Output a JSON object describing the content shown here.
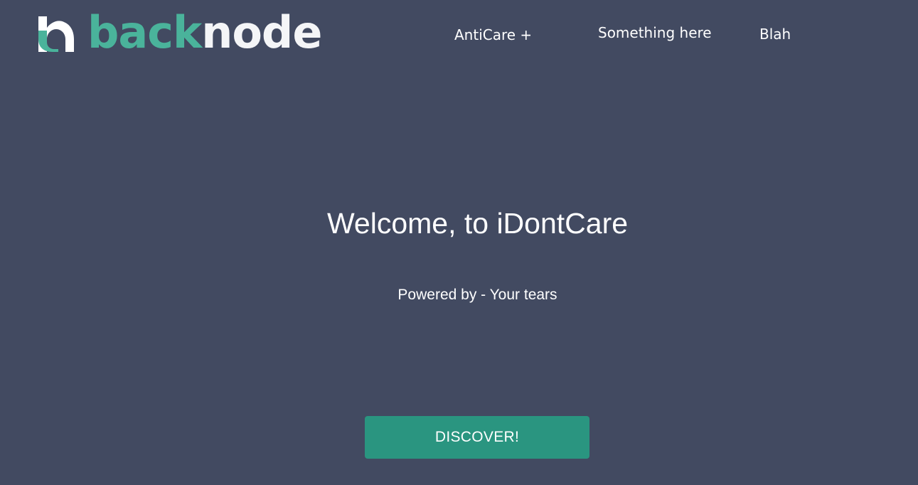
{
  "brand": {
    "name_part1": "back",
    "name_part2": "node",
    "accent_color": "#4ab39b",
    "text_color": "#f4f5f7"
  },
  "nav": {
    "items": [
      {
        "label": "AntiCare +"
      },
      {
        "label": "Something here"
      },
      {
        "label": "Blah"
      }
    ]
  },
  "hero": {
    "title": "Welcome, to iDontCare",
    "subtitle": "Powered by - Your tears",
    "cta_label": "DISCOVER!"
  },
  "colors": {
    "background": "#424a61",
    "button": "#2a9580"
  }
}
